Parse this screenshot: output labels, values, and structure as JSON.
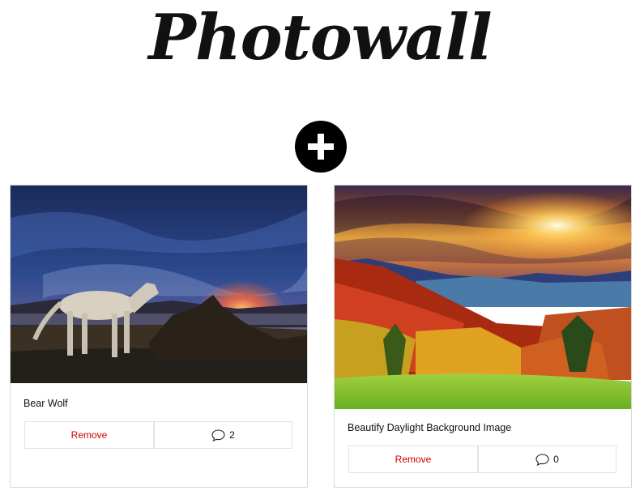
{
  "header": {
    "title": "Photowall"
  },
  "add_button": {
    "icon": "plus-icon"
  },
  "posts": [
    {
      "caption": "Bear Wolf",
      "remove_label": "Remove",
      "comment_count": "2",
      "comment_icon": "speech-bubble-icon"
    },
    {
      "caption": "Beautify Daylight Background Image",
      "remove_label": "Remove",
      "comment_count": "0",
      "comment_icon": "speech-bubble-icon"
    }
  ],
  "colors": {
    "remove_text": "#d10000",
    "add_button_bg": "#000000"
  }
}
